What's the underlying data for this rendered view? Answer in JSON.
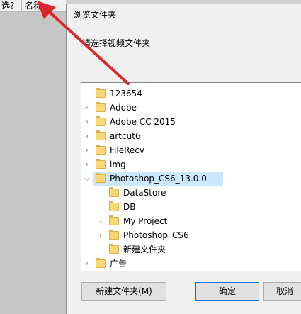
{
  "background": {
    "columns": [
      "选?",
      "名称",
      ""
    ]
  },
  "dialog": {
    "title": "浏览文件夹",
    "prompt": "请选择视频文件夹",
    "tree": [
      {
        "label": "123654",
        "level": 0,
        "expandable": false,
        "selected": false
      },
      {
        "label": "Adobe",
        "level": 0,
        "expandable": true,
        "selected": false
      },
      {
        "label": "Adobe CC 2015",
        "level": 0,
        "expandable": true,
        "selected": false
      },
      {
        "label": "artcut6",
        "level": 0,
        "expandable": true,
        "selected": false
      },
      {
        "label": "FileRecv",
        "level": 0,
        "expandable": true,
        "selected": false
      },
      {
        "label": "img",
        "level": 0,
        "expandable": true,
        "selected": false
      },
      {
        "label": "Photoshop_CS6_13.0.0",
        "level": 0,
        "expandable": true,
        "expanded": true,
        "selected": true
      },
      {
        "label": "DataStore",
        "level": 1,
        "expandable": false,
        "selected": false
      },
      {
        "label": "DB",
        "level": 1,
        "expandable": false,
        "selected": false
      },
      {
        "label": "My Project",
        "level": 1,
        "expandable": true,
        "selected": false
      },
      {
        "label": "Photoshop_CS6",
        "level": 1,
        "expandable": true,
        "selected": false
      },
      {
        "label": "新建文件夹",
        "level": 1,
        "expandable": false,
        "selected": false
      },
      {
        "label": "广告",
        "level": 0,
        "expandable": true,
        "selected": false
      }
    ],
    "buttons": {
      "new_folder": "新建文件夹(M)",
      "ok": "确定",
      "cancel": "取消"
    }
  },
  "colors": {
    "selection": "#cce8ff",
    "annotation_arrow": "#d9272e",
    "folder": "#f8d775"
  }
}
